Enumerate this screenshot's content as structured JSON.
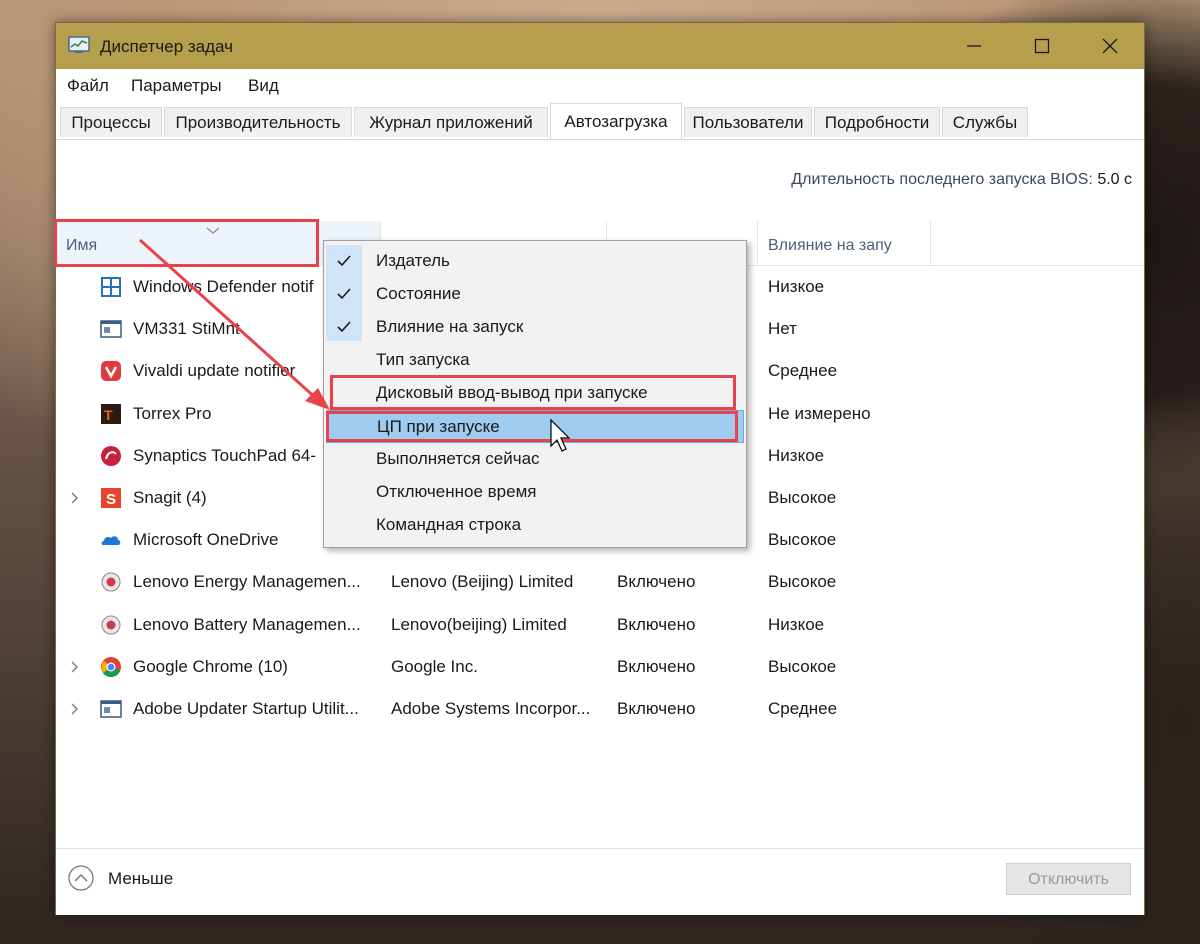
{
  "window": {
    "title": "Диспетчер задач"
  },
  "menubar": {
    "items": [
      "Файл",
      "Параметры",
      "Вид"
    ]
  },
  "tabs": [
    {
      "label": "Процессы"
    },
    {
      "label": "Производительность"
    },
    {
      "label": "Журнал приложений"
    },
    {
      "label": "Автозагрузка"
    },
    {
      "label": "Пользователи"
    },
    {
      "label": "Подробности"
    },
    {
      "label": "Службы"
    }
  ],
  "active_tab": "Автозагрузка",
  "bios": {
    "label": "Длительность последнего запуска BIOS:",
    "value": "5.0 с"
  },
  "columns": {
    "name": "Имя",
    "publisher": "",
    "status": "",
    "impact": "Влияние на запу"
  },
  "rows": [
    {
      "name": "Windows Defender notif",
      "publisher": "",
      "status": "",
      "impact": "Низкое",
      "icon": "windows-defender-icon",
      "expandable": false
    },
    {
      "name": "VM331 StiMnt",
      "publisher": "",
      "status": "",
      "impact": "Нет",
      "icon": "app-window-icon",
      "expandable": false
    },
    {
      "name": "Vivaldi update notifier",
      "publisher": "",
      "status": "",
      "impact": "Среднее",
      "icon": "vivaldi-icon",
      "expandable": false
    },
    {
      "name": "Torrex Pro",
      "publisher": "",
      "status": "",
      "impact": "Не измерено",
      "icon": "torrex-icon",
      "expandable": false
    },
    {
      "name": "Synaptics TouchPad 64-",
      "publisher": "",
      "status": "",
      "impact": "Низкое",
      "icon": "synaptics-icon",
      "expandable": false
    },
    {
      "name": "Snagit (4)",
      "publisher": "",
      "status": "",
      "impact": "Высокое",
      "icon": "snagit-icon",
      "expandable": true
    },
    {
      "name": "Microsoft OneDrive",
      "publisher": "",
      "status": "",
      "impact": "Высокое",
      "icon": "onedrive-icon",
      "expandable": false
    },
    {
      "name": "Lenovo Energy Managemen...",
      "publisher": "Lenovo (Beijing) Limited",
      "status": "Включено",
      "impact": "Высокое",
      "icon": "lenovo-icon",
      "expandable": false
    },
    {
      "name": "Lenovo Battery Managemen...",
      "publisher": "Lenovo(beijing) Limited",
      "status": "Включено",
      "impact": "Низкое",
      "icon": "lenovo-icon",
      "expandable": false
    },
    {
      "name": "Google Chrome (10)",
      "publisher": "Google Inc.",
      "status": "Включено",
      "impact": "Высокое",
      "icon": "chrome-icon",
      "expandable": true
    },
    {
      "name": "Adobe Updater Startup Utilit...",
      "publisher": "Adobe Systems Incorpor...",
      "status": "Включено",
      "impact": "Среднее",
      "icon": "app-window-icon",
      "expandable": true
    }
  ],
  "context_menu": {
    "items": [
      {
        "label": "Издатель",
        "checked": true
      },
      {
        "label": "Состояние",
        "checked": true
      },
      {
        "label": "Влияние на запуск",
        "checked": true
      },
      {
        "label": "Тип запуска",
        "checked": false
      },
      {
        "label": "Дисковый ввод-вывод при запуске",
        "checked": false
      },
      {
        "label": "ЦП при запуске",
        "checked": false,
        "highlighted": true
      },
      {
        "label": "Выполняется сейчас",
        "checked": false
      },
      {
        "label": "Отключенное время",
        "checked": false
      },
      {
        "label": "Командная строка",
        "checked": false
      }
    ]
  },
  "footer": {
    "less_label": "Меньше",
    "disable_label": "Отключить"
  },
  "colors": {
    "titlebar": "#b59f4c",
    "accent_red": "#e8424a",
    "highlight": "#9fcbee"
  }
}
